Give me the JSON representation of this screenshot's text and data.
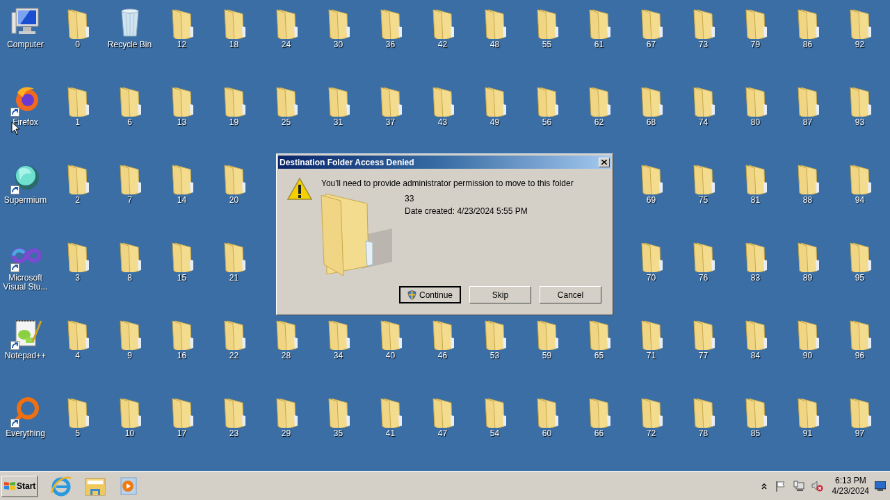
{
  "desktop": {
    "columns": [
      [
        {
          "kind": "computer",
          "label": "Computer",
          "shortcut": false
        },
        {
          "kind": "firefox",
          "label": "Firefox",
          "shortcut": true
        },
        {
          "kind": "supermium",
          "label": "Supermium",
          "shortcut": true
        },
        {
          "kind": "visual-studio",
          "label": "Microsoft Visual Stu...",
          "shortcut": true
        },
        {
          "kind": "notepad",
          "label": "Notepad++",
          "shortcut": true
        },
        {
          "kind": "everything",
          "label": "Everything",
          "shortcut": true
        }
      ],
      [
        {
          "kind": "folder",
          "label": "0"
        },
        {
          "kind": "folder",
          "label": "1"
        },
        {
          "kind": "folder",
          "label": "2"
        },
        {
          "kind": "folder",
          "label": "3"
        },
        {
          "kind": "folder",
          "label": "4"
        },
        {
          "kind": "folder",
          "label": "5"
        }
      ],
      [
        {
          "kind": "recycle-bin",
          "label": "Recycle Bin",
          "shortcut": false
        },
        {
          "kind": "folder",
          "label": "6"
        },
        {
          "kind": "folder",
          "label": "7"
        },
        {
          "kind": "folder",
          "label": "8"
        },
        {
          "kind": "folder",
          "label": "9"
        },
        {
          "kind": "folder",
          "label": "10"
        }
      ],
      [
        {
          "kind": "folder",
          "label": "12"
        },
        {
          "kind": "folder",
          "label": "13"
        },
        {
          "kind": "folder",
          "label": "14"
        },
        {
          "kind": "folder",
          "label": "15"
        },
        {
          "kind": "folder",
          "label": "16"
        },
        {
          "kind": "folder",
          "label": "17"
        }
      ],
      [
        {
          "kind": "folder",
          "label": "18"
        },
        {
          "kind": "folder",
          "label": "19"
        },
        {
          "kind": "folder",
          "label": "20"
        },
        {
          "kind": "folder",
          "label": "21"
        },
        {
          "kind": "folder",
          "label": "22"
        },
        {
          "kind": "folder",
          "label": "23"
        }
      ],
      [
        {
          "kind": "folder",
          "label": "24"
        },
        {
          "kind": "folder",
          "label": "25"
        },
        {
          "kind": "gap"
        },
        {
          "kind": "gap"
        },
        {
          "kind": "folder",
          "label": "28"
        },
        {
          "kind": "folder",
          "label": "29"
        }
      ],
      [
        {
          "kind": "folder",
          "label": "30"
        },
        {
          "kind": "folder",
          "label": "31"
        },
        {
          "kind": "gap"
        },
        {
          "kind": "gap"
        },
        {
          "kind": "folder",
          "label": "34"
        },
        {
          "kind": "folder",
          "label": "35"
        }
      ],
      [
        {
          "kind": "folder",
          "label": "36"
        },
        {
          "kind": "folder",
          "label": "37"
        },
        {
          "kind": "gap"
        },
        {
          "kind": "gap"
        },
        {
          "kind": "folder",
          "label": "40"
        },
        {
          "kind": "folder",
          "label": "41"
        }
      ],
      [
        {
          "kind": "folder",
          "label": "42"
        },
        {
          "kind": "folder",
          "label": "43"
        },
        {
          "kind": "gap"
        },
        {
          "kind": "gap"
        },
        {
          "kind": "folder",
          "label": "46"
        },
        {
          "kind": "folder",
          "label": "47"
        }
      ],
      [
        {
          "kind": "folder",
          "label": "48"
        },
        {
          "kind": "folder",
          "label": "49"
        },
        {
          "kind": "gap"
        },
        {
          "kind": "gap"
        },
        {
          "kind": "folder",
          "label": "53"
        },
        {
          "kind": "folder",
          "label": "54"
        }
      ],
      [
        {
          "kind": "folder",
          "label": "55"
        },
        {
          "kind": "folder",
          "label": "56"
        },
        {
          "kind": "gap"
        },
        {
          "kind": "gap"
        },
        {
          "kind": "folder",
          "label": "59"
        },
        {
          "kind": "folder",
          "label": "60"
        }
      ],
      [
        {
          "kind": "folder",
          "label": "61"
        },
        {
          "kind": "folder",
          "label": "62"
        },
        {
          "kind": "gap"
        },
        {
          "kind": "gap"
        },
        {
          "kind": "folder",
          "label": "65"
        },
        {
          "kind": "folder",
          "label": "66"
        }
      ],
      [
        {
          "kind": "folder",
          "label": "67"
        },
        {
          "kind": "folder",
          "label": "68"
        },
        {
          "kind": "folder",
          "label": "69"
        },
        {
          "kind": "folder",
          "label": "70"
        },
        {
          "kind": "folder",
          "label": "71"
        },
        {
          "kind": "folder",
          "label": "72"
        }
      ],
      [
        {
          "kind": "folder",
          "label": "73"
        },
        {
          "kind": "folder",
          "label": "74"
        },
        {
          "kind": "folder",
          "label": "75"
        },
        {
          "kind": "folder",
          "label": "76"
        },
        {
          "kind": "folder",
          "label": "77"
        },
        {
          "kind": "folder",
          "label": "78"
        }
      ],
      [
        {
          "kind": "folder",
          "label": "79"
        },
        {
          "kind": "folder",
          "label": "80"
        },
        {
          "kind": "folder",
          "label": "81"
        },
        {
          "kind": "folder",
          "label": "83"
        },
        {
          "kind": "folder",
          "label": "84"
        },
        {
          "kind": "folder",
          "label": "85"
        }
      ],
      [
        {
          "kind": "folder",
          "label": "86"
        },
        {
          "kind": "folder",
          "label": "87"
        },
        {
          "kind": "folder",
          "label": "88"
        },
        {
          "kind": "folder",
          "label": "89"
        },
        {
          "kind": "folder",
          "label": "90"
        },
        {
          "kind": "folder",
          "label": "91"
        }
      ],
      [
        {
          "kind": "folder",
          "label": "92"
        },
        {
          "kind": "folder",
          "label": "93"
        },
        {
          "kind": "folder",
          "label": "94"
        },
        {
          "kind": "folder",
          "label": "95"
        },
        {
          "kind": "folder",
          "label": "96"
        },
        {
          "kind": "folder",
          "label": "97"
        }
      ]
    ]
  },
  "dialog": {
    "title": "Destination Folder Access Denied",
    "message": "You'll need to provide administrator permission to move to this folder",
    "item_name": "33",
    "item_detail": "Date created: 4/23/2024 5:55 PM",
    "buttons": [
      {
        "label": "Continue",
        "shield": true,
        "default": true
      },
      {
        "label": "Skip",
        "shield": false,
        "default": false
      },
      {
        "label": "Cancel",
        "shield": false,
        "default": false
      }
    ]
  },
  "taskbar": {
    "start": "Start",
    "tray_time": "6:13 PM",
    "tray_date": "4/23/2024"
  }
}
